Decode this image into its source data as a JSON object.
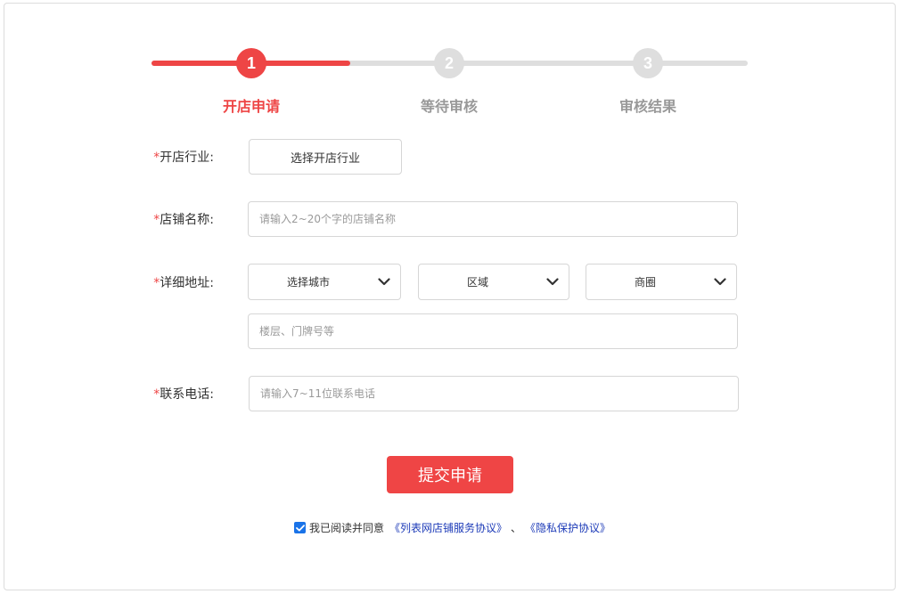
{
  "steps": [
    {
      "number": "1",
      "label": "开店申请"
    },
    {
      "number": "2",
      "label": "等待审核"
    },
    {
      "number": "3",
      "label": "审核结果"
    }
  ],
  "progress": {
    "current_step": 1,
    "total_steps": 3
  },
  "form": {
    "industry": {
      "required_mark": "*",
      "label": "开店行业:",
      "button_label": "选择开店行业"
    },
    "shop_name": {
      "required_mark": "*",
      "label": "店铺名称:",
      "placeholder": "请输入2~20个字的店铺名称",
      "value": ""
    },
    "address": {
      "required_mark": "*",
      "label": "详细地址:",
      "city": "选择城市",
      "district": "区域",
      "area": "商圈",
      "detail_placeholder": "楼层、门牌号等",
      "detail_value": ""
    },
    "phone": {
      "required_mark": "*",
      "label": "联系电话:",
      "placeholder": "请输入7~11位联系电话",
      "value": ""
    }
  },
  "submit_label": "提交申请",
  "agreement": {
    "checked": true,
    "text": "我已阅读并同意",
    "link1": "《列表网店铺服务协议》",
    "separator": "、",
    "link2": "《隐私保护协议》"
  },
  "colors": {
    "accent": "#ee4545",
    "inactive": "#dedede",
    "link": "#1d3bb8",
    "checkbox": "#1a73e8"
  }
}
